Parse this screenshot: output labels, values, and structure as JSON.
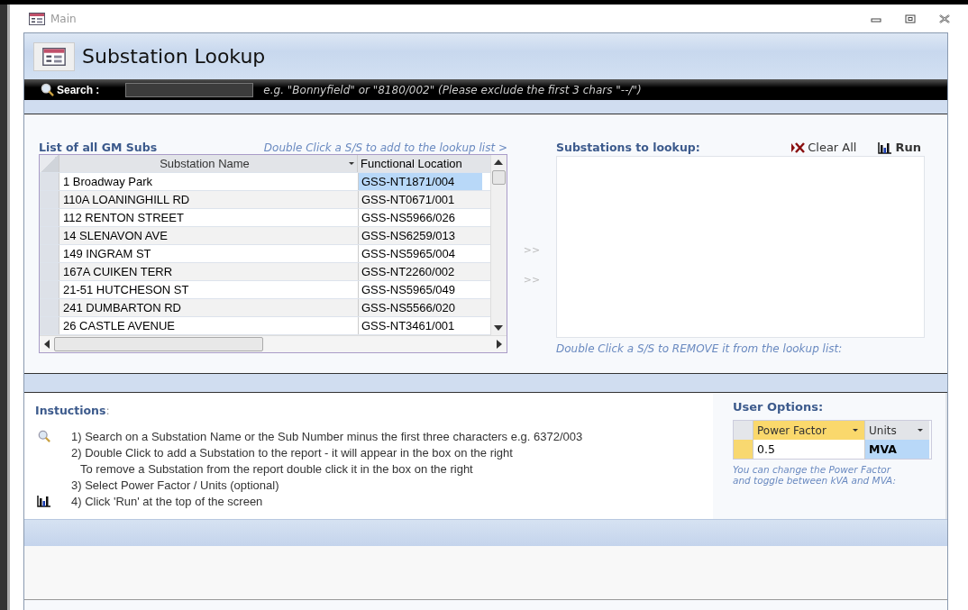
{
  "window": {
    "title": "Main"
  },
  "form": {
    "title": "Substation Lookup"
  },
  "search": {
    "label": "Search :",
    "hint": "e.g. \"Bonnyfield\" or \"8180/002\" (Please exclude the first 3 chars \"--/\")"
  },
  "sub_list": {
    "title": "List of all GM Subs",
    "hint": "Double Click a S/S to add to the lookup list >",
    "columns": [
      "Substation Name",
      "Functional Location"
    ],
    "rows": [
      {
        "name": "1 Broadway Park",
        "location": "GSS-NT1871/004",
        "selected": true
      },
      {
        "name": "110A LOANINGHILL RD",
        "location": "GSS-NT0671/001",
        "selected": false
      },
      {
        "name": "112 RENTON STREET",
        "location": "GSS-NS5966/026",
        "selected": false
      },
      {
        "name": "14 SLENAVON AVE",
        "location": "GSS-NS6259/013",
        "selected": false
      },
      {
        "name": "149 INGRAM ST",
        "location": "GSS-NS5965/004",
        "selected": false
      },
      {
        "name": "167A CUIKEN TERR",
        "location": "GSS-NT2260/002",
        "selected": false
      },
      {
        "name": "21-51 HUTCHESON ST",
        "location": "GSS-NS5965/049",
        "selected": false
      },
      {
        "name": "241 DUMBARTON RD",
        "location": "GSS-NS5566/020",
        "selected": false
      },
      {
        "name": "26 CASTLE AVENUE",
        "location": "GSS-NT3461/001",
        "selected": false
      }
    ]
  },
  "transfer_arrows": [
    ">>",
    ">>"
  ],
  "lookup": {
    "title": "Substations to lookup:",
    "actions": [
      {
        "label": "Clear All",
        "kind": "clear"
      },
      {
        "label": "Run",
        "kind": "run"
      }
    ],
    "hint": "Double Click a S/S to REMOVE it from the lookup list:"
  },
  "instructions": {
    "title": "**Instuctions**:",
    "steps": [
      {
        "text": "1) Search on a Substation Name or the Sub Number minus the first three characters e.g. 6372/003",
        "kind": "search"
      },
      {
        "text": "2) Double Click to add a Substation to the report - it will appear in the box on the right",
        "kind": "step"
      },
      {
        "text": "To remove a Substation from the report double click it in the box on the right",
        "kind": "note"
      },
      {
        "text": "3) Select Power Factor / Units (optional)",
        "kind": "step"
      },
      {
        "text": "4) Click 'Run' at the top of the screen",
        "kind": "run"
      }
    ]
  },
  "user_options": {
    "title": "User Options:",
    "columns": [
      {
        "label": "Power Factor",
        "selected": true
      },
      {
        "label": "Units",
        "selected": false
      }
    ],
    "cells": [
      {
        "value": "0.5",
        "selected": false
      },
      {
        "value": "MVA",
        "selected": true
      }
    ],
    "hint": "You can change the Power Factor\nand toggle between kVA and MVA:"
  }
}
